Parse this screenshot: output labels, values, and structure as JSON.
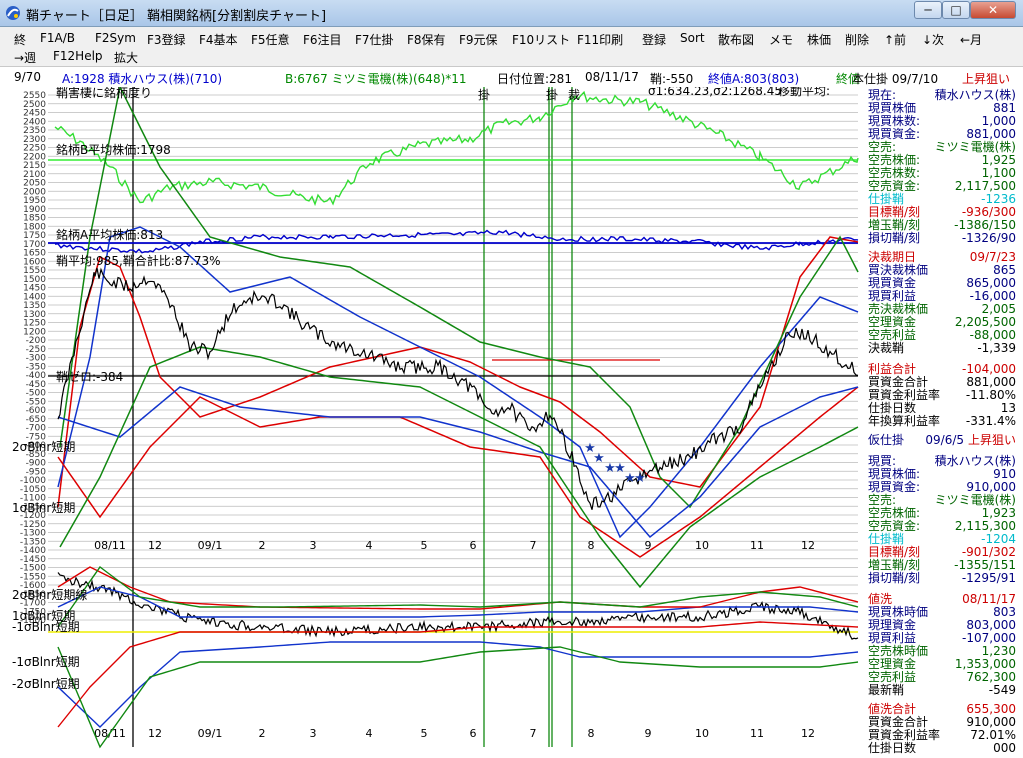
{
  "window": {
    "title": "鞘チャート［日足］ 鞘相関銘柄[分割割戻チャート]",
    "buttons": [
      "─",
      "□",
      "✕"
    ]
  },
  "menu": {
    "row1": [
      "終",
      "F1A/B",
      "F2Sym",
      "F3登録",
      "F4基本",
      "F5任意",
      "F6注目",
      "F7仕掛",
      "F8保有",
      "F9元保",
      "F10リスト",
      "F11印刷",
      "登録",
      "Sort",
      "散布図",
      "メモ",
      "株価",
      "削除",
      "↑前",
      "↓次",
      "←月"
    ],
    "row2": [
      "→週",
      "F12Help",
      "拡大"
    ]
  },
  "info": {
    "date_short": "9/70",
    "stock_a": "A:1928 積水ハウス(株)(710)",
    "stock_b": "B:6767 ミツミ電機(株)(648)*11",
    "date_pos": "日付位置:281",
    "date": "08/11/17",
    "sheath": "鞘:-550",
    "close_a": "終値A:803(803)",
    "final_label": "終値",
    "position_date": "本仕掛 09/7/10",
    "trend": "上昇狙い",
    "sigma": "σ1:634.23,σ2:1268.45",
    "moving_avg": "移動平均:"
  },
  "chart_labels": {
    "b_avg": "銘柄B平均株価:1798",
    "a_avg": "銘柄A平均株価:813",
    "sheath_avg": "鞘平均:985,鞘合計比:87.73%",
    "sheath_zero": "鞘ゼロ:-384",
    "top_note": "鞘害棲に銘柄度り",
    "band_2sigma": "2σBlnr短期",
    "band_1sigma": "1σBlnr短期",
    "band_2sigma_lower": "2σBlnr短期線",
    "band_1sigma_lower": "1σBlnr短期",
    "band_m1sigma": "-1σBlnr短期",
    "band_m1sigma_b": "-1σBlnr短期",
    "band_m2sigma": "-2σBlnr短期",
    "marker_1": "掛",
    "marker_2": "掛",
    "marker_3": "裁"
  },
  "y_ticks": [
    "2550",
    "2500",
    "2450",
    "2400",
    "2350",
    "2300",
    "2250",
    "2200",
    "2150",
    "2100",
    "2050",
    "2000",
    "1950",
    "1900",
    "1850",
    "1800",
    "1750",
    "1700",
    "1650",
    "1600",
    "1550",
    "1500",
    "1450",
    "1400",
    "1350",
    "1300",
    "1250",
    "1200",
    "-200",
    "-250",
    "-300",
    "-350",
    "-400",
    "-450",
    "-500",
    "-550",
    "-600",
    "-650",
    "-700",
    "-750",
    "-800",
    "-850",
    "-900",
    "-950",
    "-1000",
    "-1050",
    "-1100",
    "-1150",
    "-1200",
    "-1250",
    "-1300",
    "-1350",
    "-1400",
    "-1450",
    "-1500",
    "-1550",
    "-1600",
    "-1650",
    "-1700",
    "-1750",
    "-1800"
  ],
  "x_ticks": [
    "08/11",
    "12",
    "09/1",
    "2",
    "3",
    "4",
    "5",
    "6",
    "7",
    "8",
    "9",
    "10",
    "11",
    "12"
  ],
  "colors": {
    "green_series": "#33dd33",
    "blue_series": "#0000cc",
    "black_series": "#000000",
    "red_band": "#dd0000",
    "blue_band": "#1133cc",
    "green_band": "#118811",
    "avg_b_line": "#33ee33",
    "vline": "#118811",
    "yellow": "#eeee00"
  },
  "panel": [
    {
      "label": "現在:",
      "value": "積水ハウス(株)",
      "color": "#000080"
    },
    {
      "label": "現買株価",
      "value": "881",
      "color": "#000080"
    },
    {
      "label": "現買株数:",
      "value": "1,000",
      "color": "#000080"
    },
    {
      "label": "現買資金:",
      "value": "881,000",
      "color": "#000080"
    },
    {
      "label": "空売:",
      "value": "ミツミ電機(株)",
      "color": "#006400"
    },
    {
      "label": "空売株価:",
      "value": "1,925",
      "color": "#006400"
    },
    {
      "label": "空売株数:",
      "value": "1,100",
      "color": "#006400"
    },
    {
      "label": "空売資金:",
      "value": "2,117,500",
      "color": "#006400"
    },
    {
      "label": "仕掛鞘",
      "value": "-1236",
      "color": "#00bbcc"
    },
    {
      "label": "目標鞘/刻",
      "value": "-936/300",
      "color": "#cc0000"
    },
    {
      "label": "増玉鞘/刻",
      "value": "-1386/150",
      "color": "#006400"
    },
    {
      "label": "損切鞘/刻",
      "value": "-1326/90",
      "color": "#000080"
    },
    {
      "label": "決裁期日",
      "value": "09/7/23",
      "color": "#cc0000"
    },
    {
      "label": "買決裁株価",
      "value": "865",
      "color": "#000080"
    },
    {
      "label": "現買資金",
      "value": "865,000",
      "color": "#000080"
    },
    {
      "label": "現買利益",
      "value": "-16,000",
      "color": "#000080"
    },
    {
      "label": "売決裁株価",
      "value": "2,005",
      "color": "#006400"
    },
    {
      "label": "空理資金",
      "value": "2,205,500",
      "color": "#006400"
    },
    {
      "label": "空売利益",
      "value": "-88,000",
      "color": "#006400"
    },
    {
      "label": "決裁鞘",
      "value": "-1,339",
      "color": "#000000"
    },
    {
      "label": "利益合計",
      "value": "-104,000",
      "color": "#cc0000"
    },
    {
      "label": "買資金合計",
      "value": "881,000",
      "color": "#000000"
    },
    {
      "label": "買資金利益率",
      "value": "-11.80%",
      "color": "#000000"
    },
    {
      "label": "仕掛日数",
      "value": "13",
      "color": "#000000"
    },
    {
      "label": "年換算利益率",
      "value": "-331.4%",
      "color": "#000000"
    },
    {
      "label": "仮仕掛",
      "value": "09/6/5",
      "color": "#000080",
      "extra": "上昇狙い"
    },
    {
      "label": "現買:",
      "value": "積水ハウス(株)",
      "color": "#000080"
    },
    {
      "label": "現買株価:",
      "value": "910",
      "color": "#000080"
    },
    {
      "label": "現買資金:",
      "value": "910,000",
      "color": "#000080"
    },
    {
      "label": "空売:",
      "value": "ミツミ電機(株)",
      "color": "#006400"
    },
    {
      "label": "空売株価:",
      "value": "1,923",
      "color": "#006400"
    },
    {
      "label": "空売資金:",
      "value": "2,115,300",
      "color": "#006400"
    },
    {
      "label": "仕掛鞘",
      "value": "-1204",
      "color": "#00bbcc"
    },
    {
      "label": "目標鞘/刻",
      "value": "-901/302",
      "color": "#cc0000"
    },
    {
      "label": "増玉鞘/刻",
      "value": "-1355/151",
      "color": "#006400"
    },
    {
      "label": "損切鞘/刻",
      "value": "-1295/91",
      "color": "#000080"
    },
    {
      "label": "値洗",
      "value": "08/11/17",
      "color": "#cc0000"
    },
    {
      "label": "現買株時価",
      "value": "803",
      "color": "#000080"
    },
    {
      "label": "現理資金",
      "value": "803,000",
      "color": "#000080"
    },
    {
      "label": "現買利益",
      "value": "-107,000",
      "color": "#000080"
    },
    {
      "label": "空売株時価",
      "value": "1,230",
      "color": "#006400"
    },
    {
      "label": "空理資金",
      "value": "1,353,000",
      "color": "#006400"
    },
    {
      "label": "空売利益",
      "value": "762,300",
      "color": "#006400"
    },
    {
      "label": "最新鞘",
      "value": "-549",
      "color": "#000000"
    },
    {
      "label": "値洗合計",
      "value": "655,300",
      "color": "#cc0000"
    },
    {
      "label": "買資金合計",
      "value": "910,000",
      "color": "#000000"
    },
    {
      "label": "買資金利益率",
      "value": "72.01%",
      "color": "#000000"
    },
    {
      "label": "仕掛日数",
      "value": "000",
      "color": "#000000"
    }
  ]
}
